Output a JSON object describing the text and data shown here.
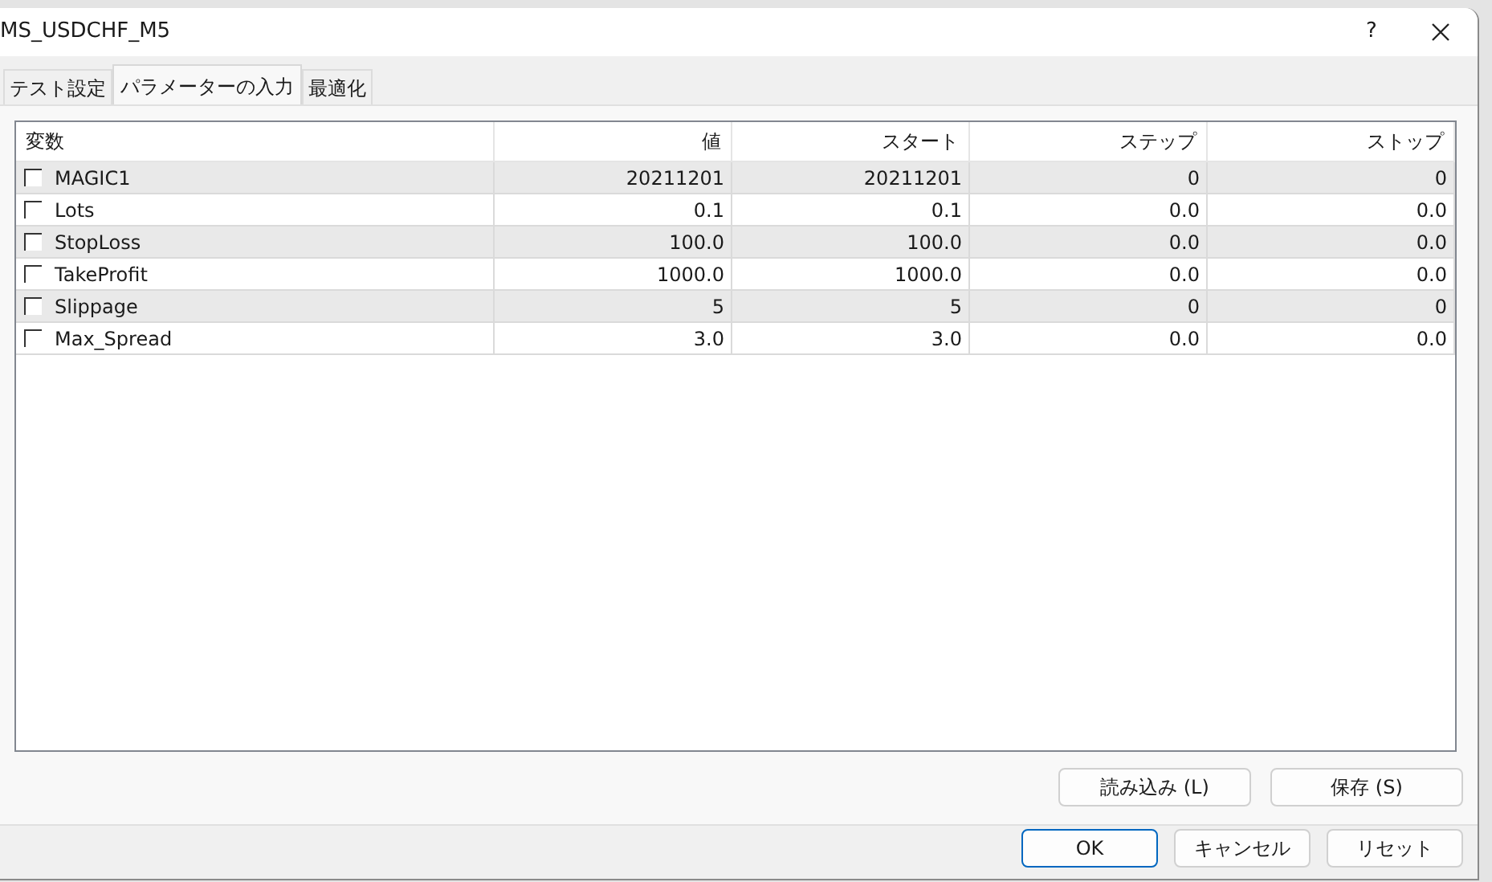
{
  "window": {
    "title": "MS_USDCHF_M5",
    "help": "?"
  },
  "tabs": [
    {
      "label": "テスト設定",
      "selected": false
    },
    {
      "label": "パラメーターの入力",
      "selected": true
    },
    {
      "label": "最適化",
      "selected": false
    }
  ],
  "table": {
    "columns": [
      "変数",
      "値",
      "スタート",
      "ステップ",
      "ストップ"
    ],
    "rows": [
      {
        "checked": false,
        "cells": [
          "MAGIC1",
          "20211201",
          "20211201",
          "0",
          "0"
        ]
      },
      {
        "checked": false,
        "cells": [
          "Lots",
          "0.1",
          "0.1",
          "0.0",
          "0.0"
        ]
      },
      {
        "checked": false,
        "cells": [
          "StopLoss",
          "100.0",
          "100.0",
          "0.0",
          "0.0"
        ]
      },
      {
        "checked": false,
        "cells": [
          "TakeProfit",
          "1000.0",
          "1000.0",
          "0.0",
          "0.0"
        ]
      },
      {
        "checked": false,
        "cells": [
          "Slippage",
          "5",
          "5",
          "0",
          "0"
        ]
      },
      {
        "checked": false,
        "cells": [
          "Max_Spread",
          "3.0",
          "3.0",
          "0.0",
          "0.0"
        ]
      }
    ]
  },
  "panel_buttons": [
    "読み込み (L)",
    "保存 (S)"
  ],
  "dialog_buttons": [
    {
      "label": "OK",
      "default": true
    },
    {
      "label": "キャンセル",
      "default": false
    },
    {
      "label": "リセット",
      "default": false
    }
  ]
}
